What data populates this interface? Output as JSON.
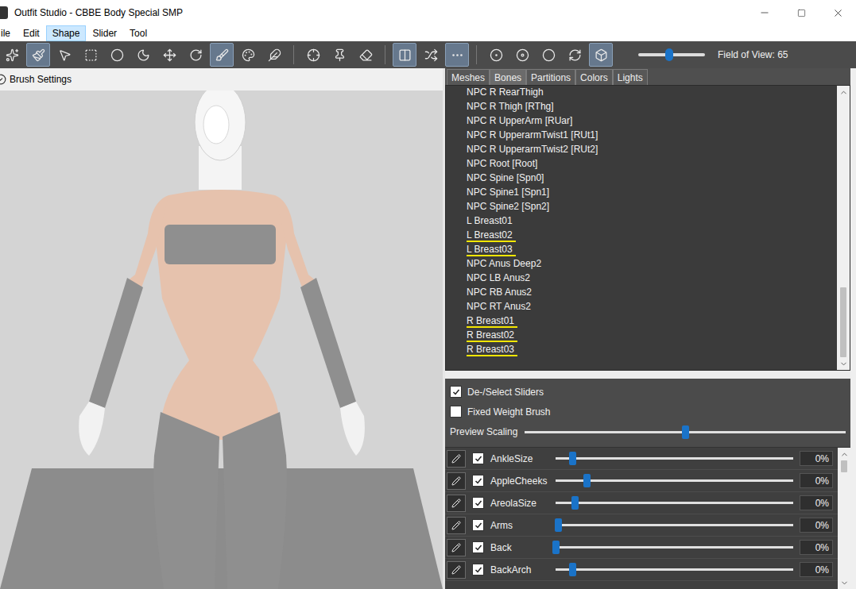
{
  "window": {
    "title": "Outfit Studio - CBBE Body Special SMP"
  },
  "menu": [
    {
      "label": "ile",
      "selected": false
    },
    {
      "label": "Edit",
      "selected": false
    },
    {
      "label": "Shape",
      "selected": true
    },
    {
      "label": "Slider",
      "selected": false
    },
    {
      "label": "Tool",
      "selected": false
    }
  ],
  "toolbar": {
    "groups": [
      [
        {
          "selected": false
        },
        {
          "selected": true
        },
        {
          "selected": false
        },
        {
          "selected": false
        },
        {
          "selected": false
        },
        {
          "selected": false
        },
        {
          "selected": false
        },
        {
          "selected": false
        },
        {
          "selected": true
        },
        {
          "selected": false
        },
        {
          "selected": false
        }
      ],
      [
        {
          "selected": false
        },
        {
          "selected": false
        },
        {
          "selected": false
        }
      ],
      [
        {
          "selected": true
        },
        {
          "selected": false
        },
        {
          "selected": true
        }
      ],
      [
        {
          "selected": false
        },
        {
          "selected": false
        },
        {
          "selected": false
        },
        {
          "selected": false
        },
        {
          "selected": true
        }
      ]
    ],
    "fov": {
      "label": "Field of View: 65",
      "level": 0.46
    }
  },
  "brush_settings": {
    "label": "Brush Settings"
  },
  "tabs": [
    {
      "label": "Meshes",
      "selected": false
    },
    {
      "label": "Bones",
      "selected": true
    },
    {
      "label": "Partitions",
      "selected": false
    },
    {
      "label": "Colors",
      "selected": false
    },
    {
      "label": "Lights",
      "selected": false
    }
  ],
  "bones": {
    "scroll_level": 1,
    "items": [
      {
        "name": "NPC R RearThigh",
        "marked": false
      },
      {
        "name": "NPC R Thigh [RThg]",
        "marked": false
      },
      {
        "name": "NPC R UpperArm [RUar]",
        "marked": false
      },
      {
        "name": "NPC R UpperarmTwist1 [RUt1]",
        "marked": false
      },
      {
        "name": "NPC R UpperarmTwist2 [RUt2]",
        "marked": false
      },
      {
        "name": "NPC Root [Root]",
        "marked": false
      },
      {
        "name": "NPC Spine [Spn0]",
        "marked": false
      },
      {
        "name": "NPC Spine1 [Spn1]",
        "marked": false
      },
      {
        "name": "NPC Spine2 [Spn2]",
        "marked": false
      },
      {
        "name": "L Breast01",
        "marked": false
      },
      {
        "name": "L Breast02",
        "marked": true
      },
      {
        "name": "L Breast03",
        "marked": true
      },
      {
        "name": "NPC Anus Deep2",
        "marked": false
      },
      {
        "name": "NPC LB Anus2",
        "marked": false
      },
      {
        "name": "NPC RB Anus2",
        "marked": false
      },
      {
        "name": "NPC RT Anus2",
        "marked": false
      },
      {
        "name": "R Breast01",
        "marked": true
      },
      {
        "name": "R Breast02",
        "marked": true
      },
      {
        "name": "R Breast03",
        "marked": true
      }
    ]
  },
  "options": [
    {
      "label": "De-/Select Sliders",
      "checked": true
    },
    {
      "label": "Fixed Weight Brush",
      "checked": false
    }
  ],
  "preview_scaling": {
    "label": "Preview Scaling",
    "level": 0.5
  },
  "sliders": {
    "scroll_level": 0,
    "items": [
      {
        "name": "AnkleSize",
        "checked": true,
        "value": "0%",
        "level": 0.07
      },
      {
        "name": "AppleCheeks",
        "checked": true,
        "value": "0%",
        "level": 0.13
      },
      {
        "name": "AreolaSize",
        "checked": true,
        "value": "0%",
        "level": 0.08
      },
      {
        "name": "Arms",
        "checked": true,
        "value": "0%",
        "level": 0.01
      },
      {
        "name": "Back",
        "checked": true,
        "value": "0%",
        "level": 0.0
      },
      {
        "name": "BackArch",
        "checked": true,
        "value": "0%",
        "level": 0.07
      }
    ]
  }
}
